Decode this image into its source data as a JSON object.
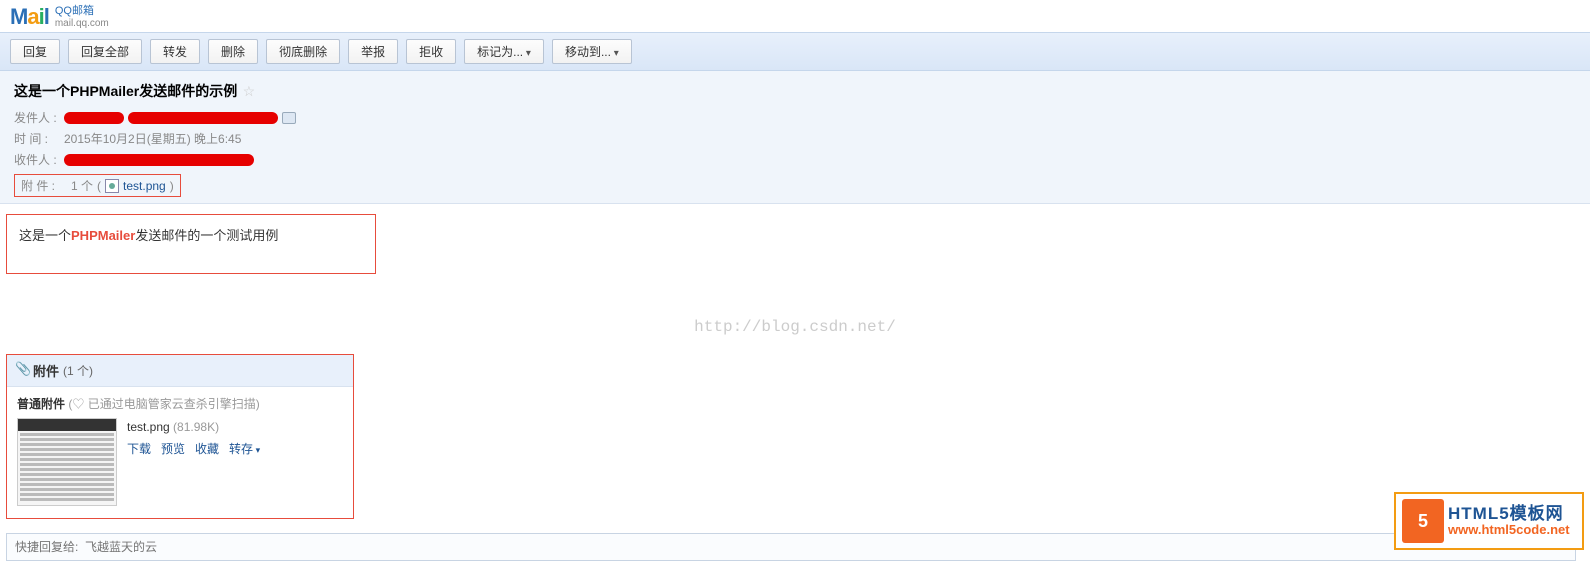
{
  "logo": {
    "brand": "QQ邮箱",
    "domain": "mail.qq.com"
  },
  "toolbar": {
    "reply": "回复",
    "reply_all": "回复全部",
    "forward": "转发",
    "delete": "删除",
    "delete_perm": "彻底删除",
    "report": "举报",
    "reject": "拒收",
    "mark_as": "标记为...",
    "move_to": "移动到..."
  },
  "mail": {
    "subject": "这是一个PHPMailer发送邮件的示例",
    "from_label": "发件人 :",
    "time_label": "时   间 :",
    "time_value": "2015年10月2日(星期五) 晚上6:45",
    "to_label": "收件人 :",
    "att_label": "附   件 :",
    "att_count_text": "1 个",
    "att_filename": "test.png",
    "body_pre": "这是一个",
    "body_hl": "PHPMailer",
    "body_post": "发送邮件的一个测试用例"
  },
  "watermark": "http://blog.csdn.net/",
  "attachments": {
    "section_title": "附件",
    "section_count": "(1 个)",
    "normal_label": "普通附件",
    "scan_text": "已通过电脑管家云查杀引擎扫描",
    "file_name": "test.png",
    "file_size": "(81.98K)",
    "actions": {
      "download": "下载",
      "preview": "预览",
      "favorite": "收藏",
      "forward": "转存"
    }
  },
  "quick_reply": {
    "placeholder": "快捷回复给:  飞越蓝天的云"
  },
  "badge": {
    "icon_text": "5",
    "line1": "HTML5模板网",
    "line2": "www.html5code.net"
  }
}
